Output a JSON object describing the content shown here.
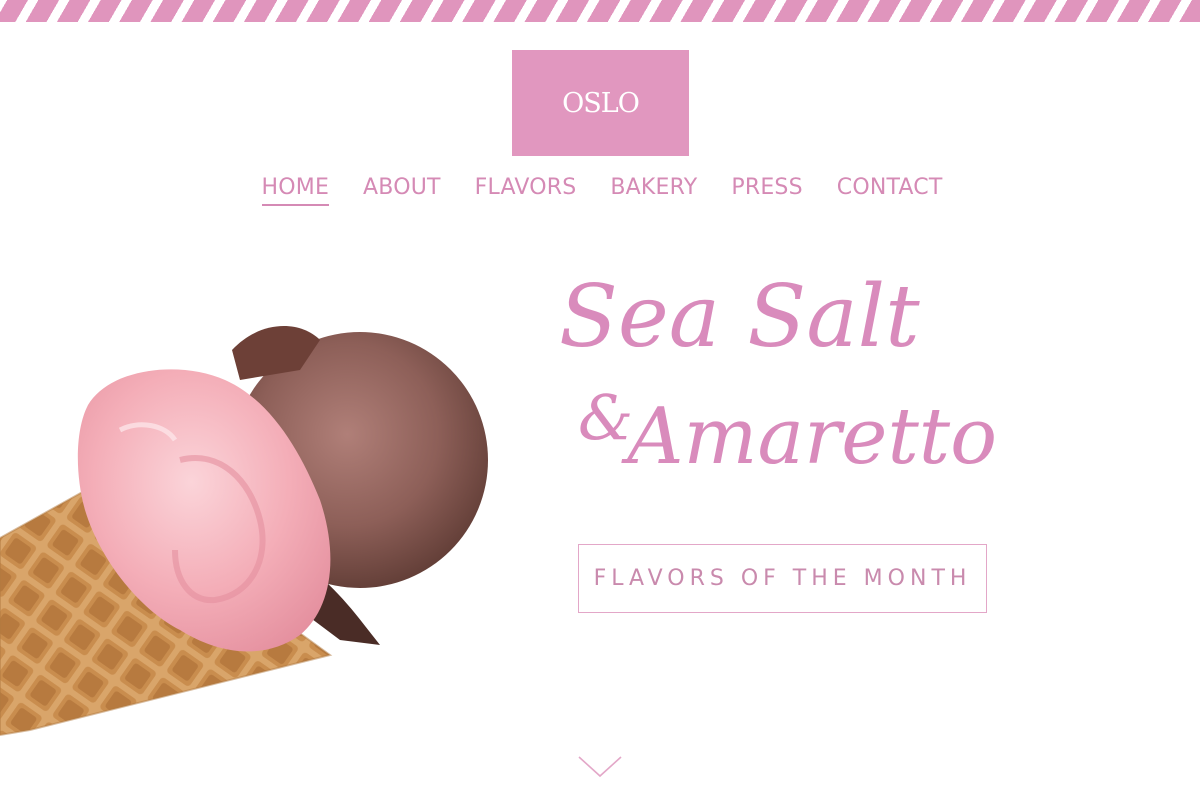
{
  "brand": {
    "logo_text": "OSLO",
    "accent_color": "#e197bf",
    "text_color": "#d883b3"
  },
  "nav": {
    "items": [
      {
        "label": "HOME",
        "active": true
      },
      {
        "label": "ABOUT",
        "active": false
      },
      {
        "label": "FLAVORS",
        "active": false
      },
      {
        "label": "BAKERY",
        "active": false
      },
      {
        "label": "PRESS",
        "active": false
      },
      {
        "label": "CONTACT",
        "active": false
      }
    ]
  },
  "hero": {
    "headline_line1": "Sea Salt",
    "headline_amp": "&",
    "headline_line2": "Amaretto",
    "cta_label": "FLAVORS OF THE MONTH",
    "image": "ice-cream-cone",
    "scroll_icon": "chevron-down-icon"
  }
}
